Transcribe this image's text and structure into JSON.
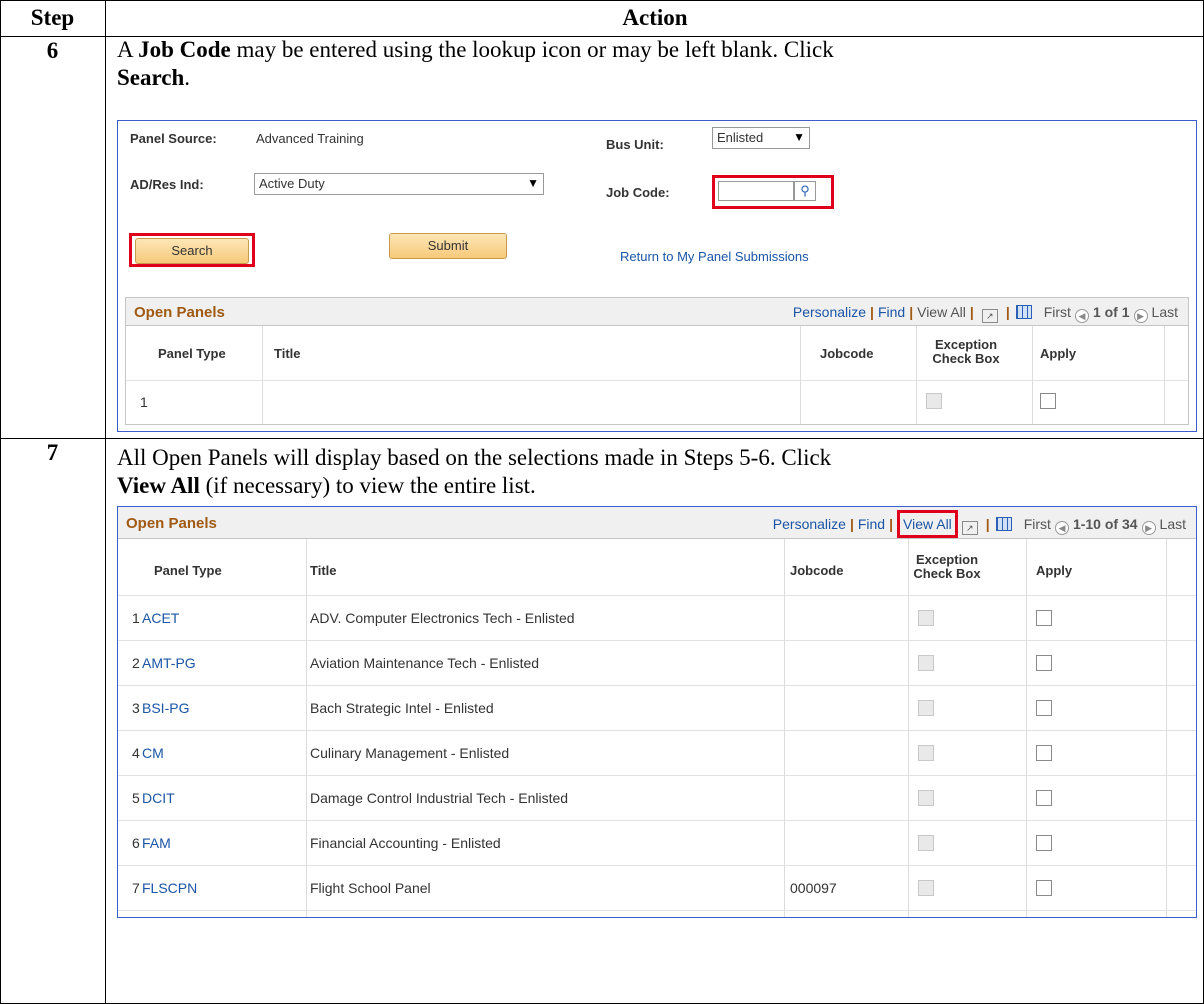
{
  "header": {
    "step": "Step",
    "action": "Action"
  },
  "step6": {
    "number": "6",
    "text_a": "A ",
    "bold_a": "Job Code",
    "text_b": " may be entered using the lookup icon or may be left blank.  Click ",
    "bold_b": "Search",
    "text_c": ".",
    "panel": {
      "panel_source_label": "Panel Source:",
      "panel_source_value": "Advanced Training",
      "bus_unit_label": "Bus Unit:",
      "bus_unit_value": "Enlisted",
      "adres_label": "AD/Res Ind:",
      "adres_value": "Active Duty",
      "job_code_label": "Job Code:",
      "job_code_value": "",
      "search_label": "Search",
      "submit_label": "Submit",
      "return_link": "Return to My Panel Submissions",
      "grid": {
        "title": "Open Panels",
        "personalize": "Personalize",
        "find": "Find",
        "view_all": "View All",
        "first": "First",
        "range": "1 of 1",
        "last": "Last",
        "columns": [
          "Panel Type",
          "Title",
          "Jobcode",
          "Exception",
          "Check Box",
          "Apply"
        ],
        "rows": [
          {
            "num": "1",
            "type": "",
            "title": "",
            "jobcode": ""
          }
        ]
      }
    }
  },
  "step7": {
    "number": "7",
    "text_a": "All Open Panels will display based on the selections made in Steps 5-6.  Click",
    "bold_a": "View All",
    "text_b": " (if necessary) to view the entire list.",
    "grid": {
      "title": "Open Panels",
      "personalize": "Personalize",
      "find": "Find",
      "view_all": "View All",
      "first": "First",
      "range": "1-10 of 34",
      "last": "Last",
      "columns": [
        "Panel Type",
        "Title",
        "Jobcode",
        "Exception",
        "Check Box",
        "Apply"
      ],
      "rows": [
        {
          "num": "1",
          "type": "ACET",
          "title": "ADV. Computer Electronics Tech - Enlisted",
          "jobcode": ""
        },
        {
          "num": "2",
          "type": "AMT-PG",
          "title": "Aviation Maintenance Tech - Enlisted",
          "jobcode": ""
        },
        {
          "num": "3",
          "type": "BSI-PG",
          "title": "Bach Strategic Intel - Enlisted",
          "jobcode": ""
        },
        {
          "num": "4",
          "type": "CM",
          "title": "Culinary Management - Enlisted",
          "jobcode": ""
        },
        {
          "num": "5",
          "type": "DCIT",
          "title": "Damage Control Industrial Tech - Enlisted",
          "jobcode": ""
        },
        {
          "num": "6",
          "type": "FAM",
          "title": "Financial Accounting - Enlisted",
          "jobcode": ""
        },
        {
          "num": "7",
          "type": "FLSCPN",
          "title": "Flight School Panel",
          "jobcode": "000097"
        }
      ]
    }
  },
  "colors": {
    "highlight": "#e0001b",
    "link": "#1a55a6",
    "grid_title": "#a15a13",
    "frame": "#3a5fcd"
  }
}
